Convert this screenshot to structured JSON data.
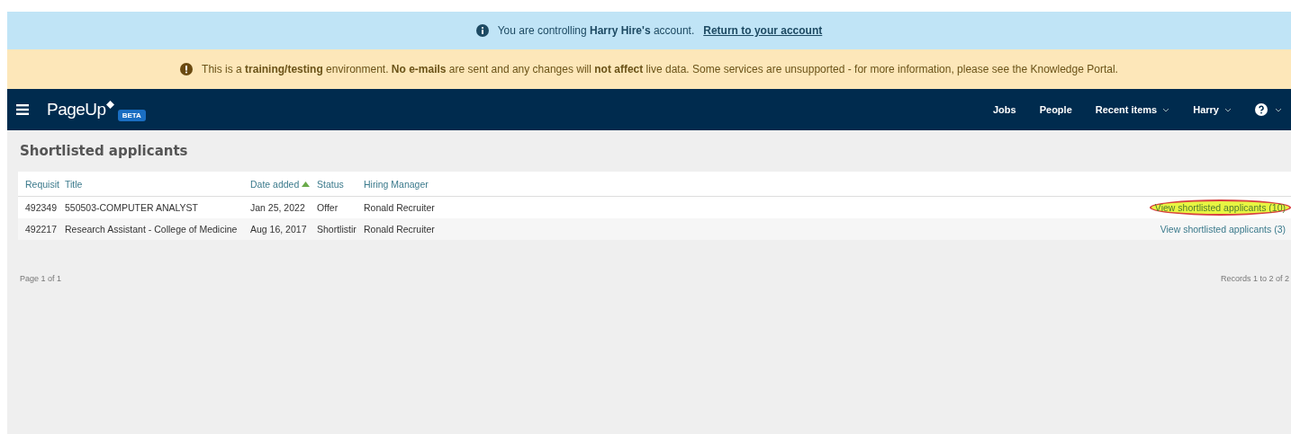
{
  "impersonation_banner": {
    "text": "You are controlling **Harry Hire's** account.",
    "link": "Return to your account"
  },
  "training_banner": {
    "text": "This is a **training/testing** environment. **No e-mails** are sent and any changes will **not affect** live data. Some services are unsupported - for more information, please see the Knowledge Portal."
  },
  "navbar": {
    "logo": "PageUp",
    "badge": "BETA",
    "items": [
      {
        "label": "Jobs",
        "kind": "link"
      },
      {
        "label": "People",
        "kind": "link"
      },
      {
        "label": "Recent items",
        "kind": "dropdown"
      },
      {
        "label": "Harry",
        "kind": "dropdown"
      }
    ]
  },
  "page_title": "Shortlisted applicants",
  "table": {
    "columns": [
      {
        "label": "Requisit",
        "sorted": false
      },
      {
        "label": "Title",
        "sorted": false
      },
      {
        "label": "Date added",
        "sorted": true
      },
      {
        "label": "Status",
        "sorted": false
      },
      {
        "label": "Hiring Manager",
        "sorted": false
      }
    ],
    "rows": [
      {
        "cells": [
          "492349",
          "550503-COMPUTER ANALYST",
          "Jan 25, 2022",
          "Offer",
          "Ronald Recruiter"
        ],
        "link": "View shortlisted applicants (10)",
        "highlighted": true
      },
      {
        "cells": [
          "492217",
          "Research Assistant - College of Medicine",
          "Aug 16, 2017",
          "Shortlistir",
          "Ronald Recruiter"
        ],
        "link": "View shortlisted applicants (3)",
        "highlighted": false
      }
    ]
  },
  "pagination": {
    "page": "Page 1 of 1",
    "records": "Records 1 to 2 of 2"
  }
}
